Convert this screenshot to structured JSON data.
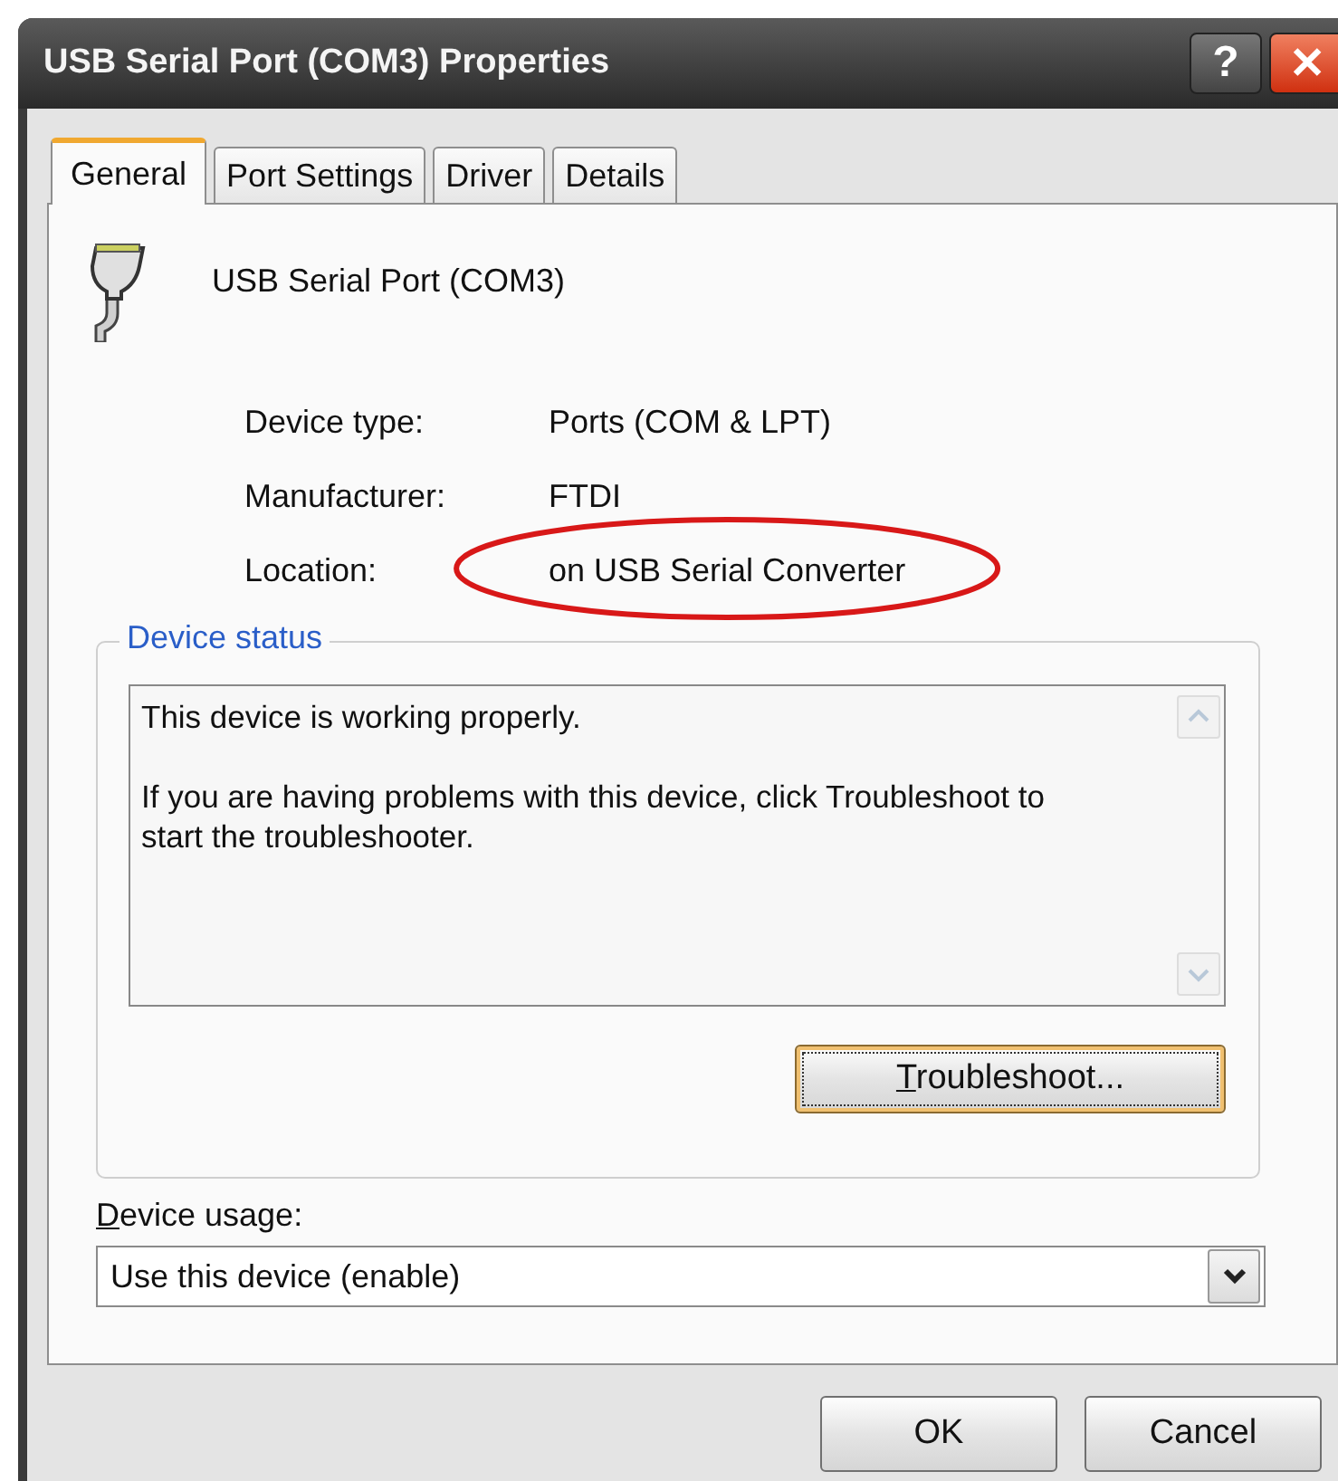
{
  "window": {
    "title": "USB Serial Port (COM3) Properties",
    "title_buttons": [
      "?",
      "✕"
    ]
  },
  "tabs": [
    {
      "label": "General",
      "selected": true
    },
    {
      "label": "Port Settings",
      "selected": false
    },
    {
      "label": "Driver",
      "selected": false
    },
    {
      "label": "Details",
      "selected": false
    }
  ],
  "device": {
    "name": "USB Serial Port (COM3)"
  },
  "properties": [
    {
      "label": "Device type:",
      "value": "Ports (COM & LPT)",
      "highlighted": false
    },
    {
      "label": "Manufacturer:",
      "value": "FTDI",
      "highlighted": false
    },
    {
      "label": "Location:",
      "value": "on USB Serial Converter",
      "highlighted": true
    }
  ],
  "device_status": {
    "title": "Device status",
    "lines": [
      "This device is working properly.",
      "If you are having problems with this device, click Troubleshoot to start the troubleshooter."
    ],
    "button": {
      "label": "Troubleshoot...",
      "underline_first": true
    }
  },
  "device_usage": {
    "label": "Device usage:",
    "underline_first": true,
    "value": "Use this device (enable)"
  },
  "buttons": [
    {
      "label": "OK",
      "default": false
    },
    {
      "label": "Cancel",
      "default": false
    }
  ]
}
